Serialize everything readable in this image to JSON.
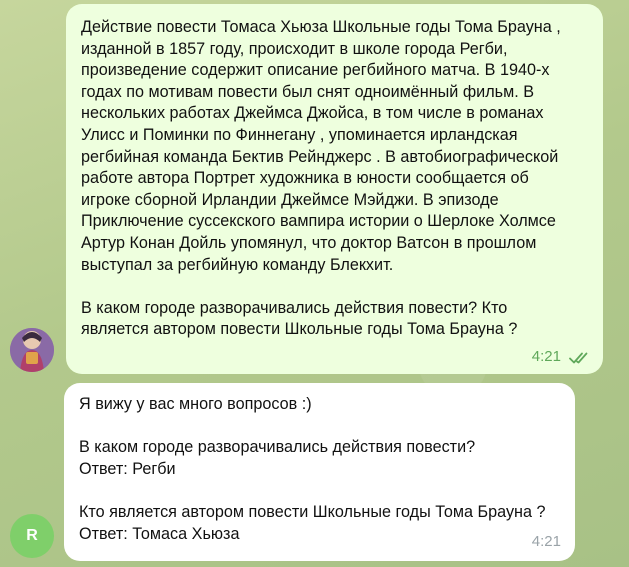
{
  "messages": {
    "outgoing": {
      "text": "Действие повести Томаса Хьюза Школьные годы Тома Брауна ,\nизданной в 1857 году, происходит в школе города Регби,\nпроизведение содержит описание регбийного матча. В 1940-х\nгодах по мотивам повести был снят одноимённый фильм. В\nнескольких работах Джеймса Джойса, в том числе в романах\nУлисс и Поминки по Финнегану , упоминается ирландская\nрегбийная команда Бектив Рейнджерс . В автобиографической\nработе автора Портрет художника в юности сообщается об\nигроке сборной Ирландии Джеймсе Мэйджи. В эпизоде\nПриключение суссекского вампира истории о Шерлоке Холмсе\nАртур Конан Дойль упомянул, что доктор Ватсон в прошлом\nвыступал за регбийную команду Блекхит.\n\nВ каком городе разворачивались действия повести? Кто\nявляется автором повести Школьные годы Тома Брауна ?",
      "time": "4:21",
      "status_icon": "double-check-read-icon"
    },
    "incoming": {
      "text": "Я вижу у вас много вопросов :)\n\nВ каком городе разворачивались действия повести?\nОтвет: Регби\n\nКто является автором повести Школьные годы Тома Брауна ?\nОтвет: Томаса Хьюза",
      "time": "4:21"
    }
  },
  "avatars": {
    "user_icon": "user-avatar-icon",
    "bot_letter": "R",
    "bot_color": "#7fcf6a"
  },
  "colors": {
    "outgoing_bubble": "#eeffde",
    "incoming_bubble": "#ffffff",
    "wallpaper": "#b9cc93",
    "read_check": "#5fa85a"
  }
}
